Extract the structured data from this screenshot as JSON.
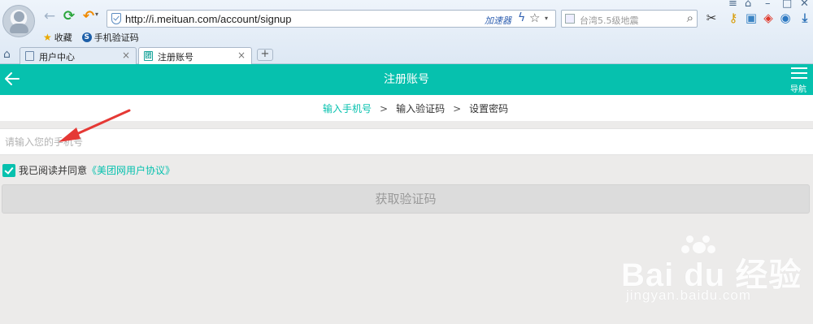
{
  "browser": {
    "url": "http://i.meituan.com/account/signup",
    "accelerator_label": "加速器",
    "search_placeholder": "台湾5.5级地震",
    "bookmarks": [
      {
        "label": "收藏",
        "icon": "star-icon"
      },
      {
        "label": "手机验证码",
        "icon": "sogou-icon"
      }
    ],
    "tabs": [
      {
        "label": "用户中心",
        "active": false
      },
      {
        "label": "注册账号",
        "active": true
      }
    ],
    "new_tab_label": "+"
  },
  "header": {
    "title": "注册账号",
    "nav_label": "导航",
    "background": "#06c1ae"
  },
  "steps": [
    {
      "label": "输入手机号",
      "active": true
    },
    {
      "label": "输入验证码",
      "active": false
    },
    {
      "label": "设置密码",
      "active": false
    }
  ],
  "step_separator": ">",
  "form": {
    "phone_placeholder": "请输入您的手机号",
    "agree_text": "我已阅读并同意",
    "agree_link": "《美团网用户协议》",
    "agree_checked": true,
    "submit_label": "获取验证码"
  },
  "watermark": {
    "brand": "Bai du 经验",
    "url": "jingyan.baidu.com"
  },
  "colors": {
    "accent": "#06c1ae",
    "disabled_button": "#dcdcdc",
    "annotation_arrow": "#e53935"
  }
}
